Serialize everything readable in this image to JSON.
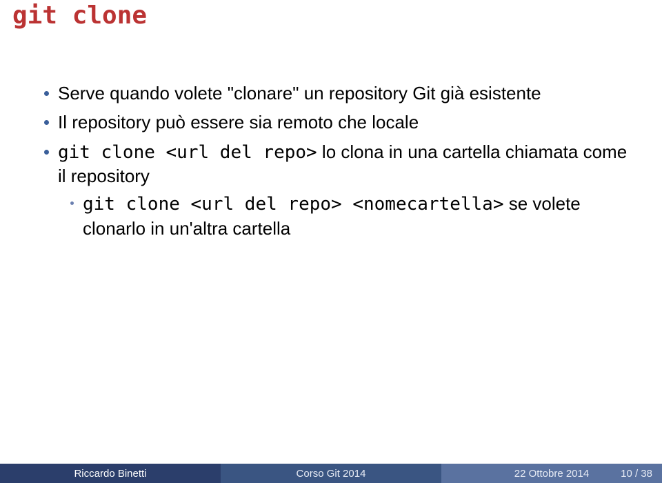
{
  "title": "git clone",
  "bullets": [
    {
      "text": "Serve quando volete \"clonare\" un repository Git già esistente"
    },
    {
      "text": "Il repository può essere sia remoto che locale"
    },
    {
      "lead": "git clone <url del repo>",
      "rest": " lo clona in una cartella chiamata come il repository"
    },
    {
      "lead": "git clone <url del repo> <nomecartella>",
      "rest": " se volete clonarlo in un'altra cartella"
    }
  ],
  "footer": {
    "author": "Riccardo Binetti",
    "center": "Corso Git 2014",
    "date": "22 Ottobre 2014",
    "page": "10 / 38"
  }
}
